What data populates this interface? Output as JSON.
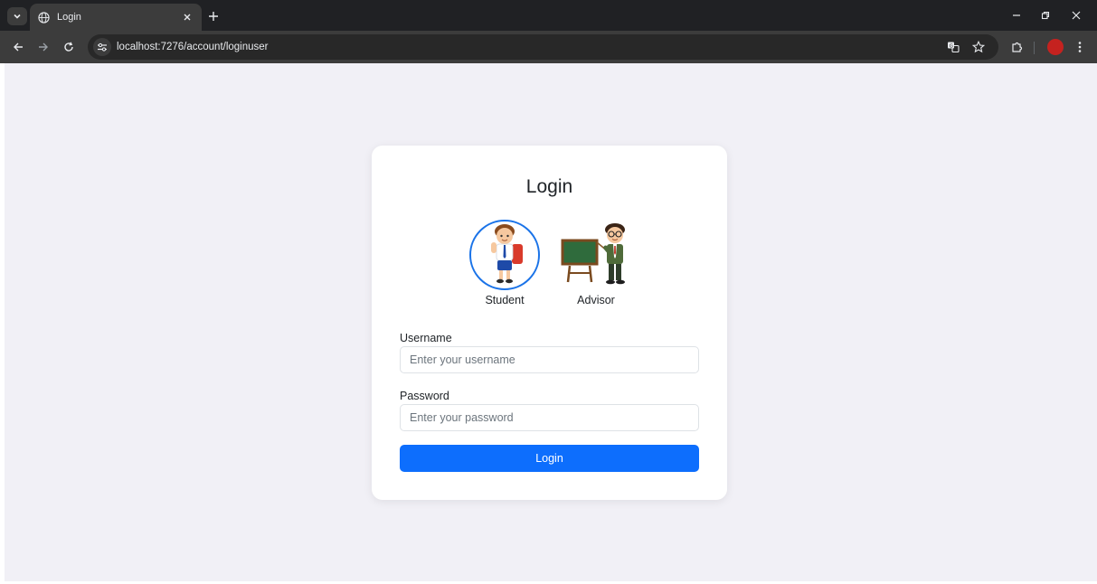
{
  "browser": {
    "tab_title": "Login",
    "url": "localhost:7276/account/loginuser"
  },
  "login": {
    "title": "Login",
    "roles": [
      {
        "label": "Student",
        "selected": true
      },
      {
        "label": "Advisor",
        "selected": false
      }
    ],
    "username": {
      "label": "Username",
      "placeholder": "Enter your username",
      "value": ""
    },
    "password": {
      "label": "Password",
      "placeholder": "Enter your password",
      "value": ""
    },
    "submit_label": "Login"
  },
  "colors": {
    "primary": "#0d6efd",
    "selected_ring": "#1a73e8",
    "page_bg": "#f1f0f6",
    "chrome_dark": "#202124",
    "chrome_toolbar": "#3c3c3c"
  },
  "icons": {
    "tab_search": "chevron-down-icon",
    "favicon": "globe-icon",
    "tab_close": "close-icon",
    "new_tab": "plus-icon",
    "back": "arrow-left-icon",
    "forward": "arrow-right-icon",
    "reload": "reload-icon",
    "site_info": "tune-icon",
    "translate": "translate-icon",
    "bookmark": "star-icon",
    "extensions": "puzzle-icon",
    "menu": "kebab-menu-icon"
  }
}
